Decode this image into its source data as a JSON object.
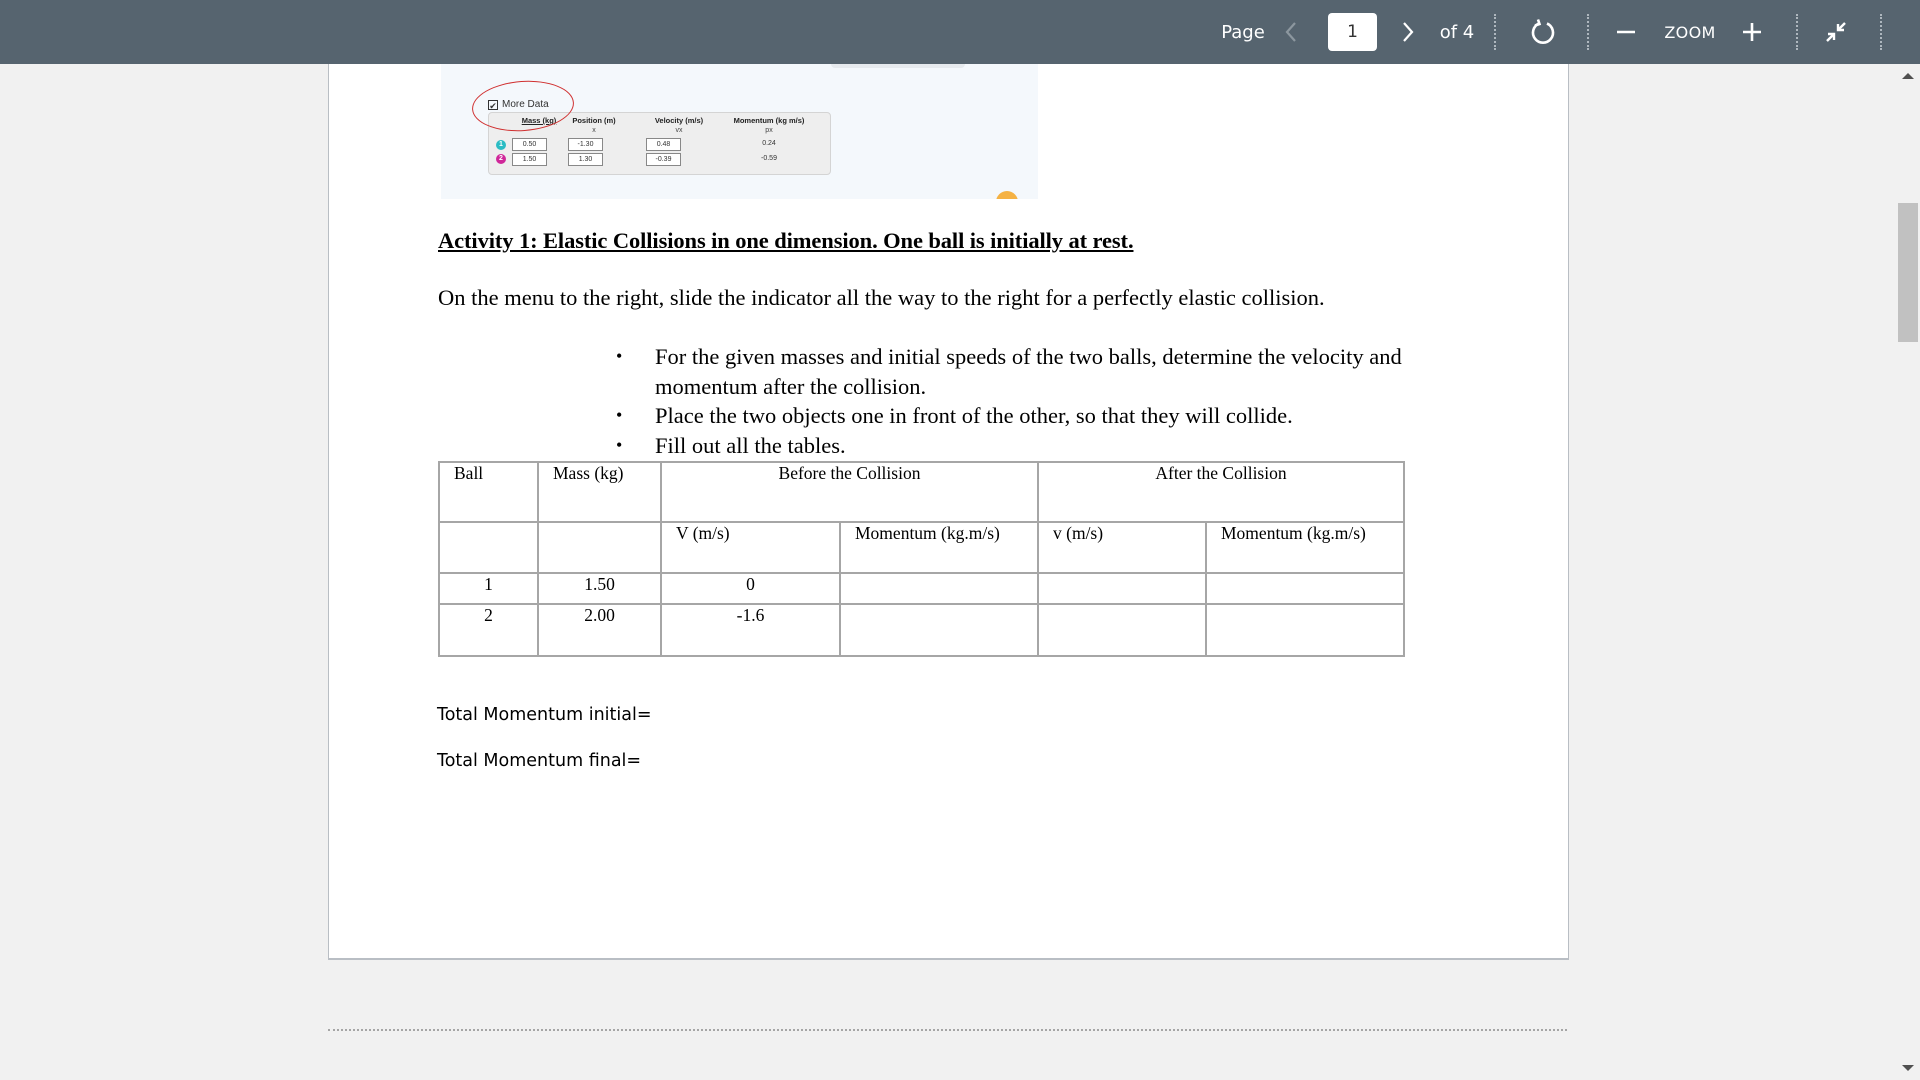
{
  "toolbar": {
    "page_label": "Page",
    "current_page": "1",
    "total_pages_label": "of 4",
    "zoom_label": "ZOOM",
    "icons": {
      "prev": "chevron-left-icon",
      "next": "chevron-right-icon",
      "refresh": "refresh-icon",
      "zoom_out": "minus-icon",
      "zoom_in": "plus-icon",
      "collapse": "collapse-icon"
    },
    "colors": {
      "background": "#56646f",
      "text": "#ffffff"
    }
  },
  "embedded_screenshot": {
    "checkbox_label": "More Data",
    "checkbox_checked": true,
    "columns": [
      {
        "header": "Mass (kg)",
        "sub": ""
      },
      {
        "header": "Position (m)",
        "sub": "x"
      },
      {
        "header": "Velocity (m/s)",
        "sub": "vx"
      },
      {
        "header": "Momentum (kg m/s)",
        "sub": "px"
      }
    ],
    "rows": [
      {
        "ball": "1",
        "mass": "0.50",
        "position": "-1.30",
        "velocity": "0.48",
        "momentum": "0.24",
        "color": "#2bbcc4"
      },
      {
        "ball": "2",
        "mass": "1.50",
        "position": "1.30",
        "velocity": "-0.39",
        "momentum": "-0.59",
        "color": "#d0279a"
      }
    ]
  },
  "document": {
    "heading": "Activity 1: Elastic Collisions in one dimension. One ball is initially at rest.",
    "intro": "On the menu to the right, slide the indicator all the way to the right for a perfectly elastic collision.",
    "bullets": [
      "For the given masses and initial speeds of the two balls, determine the velocity and momentum after the collision.",
      "Place the two objects one in front of the other, so that they will collide.",
      "Fill out all the tables."
    ],
    "bullet_char": "•",
    "table": {
      "header_row": [
        "Ball",
        "Mass (kg)",
        "Before the Collision",
        "After the Collision"
      ],
      "sub_header_row": [
        "",
        "",
        "V (m/s)",
        "Momentum (kg.m/s)",
        "v (m/s)",
        "Momentum (kg.m/s)"
      ],
      "rows": [
        [
          "1",
          "1.50",
          "0",
          "",
          "",
          ""
        ],
        [
          "2",
          "2.00",
          "-1.6",
          "",
          "",
          ""
        ]
      ]
    },
    "total_initial": "Total Momentum initial=",
    "total_final": "Total Momentum final="
  }
}
